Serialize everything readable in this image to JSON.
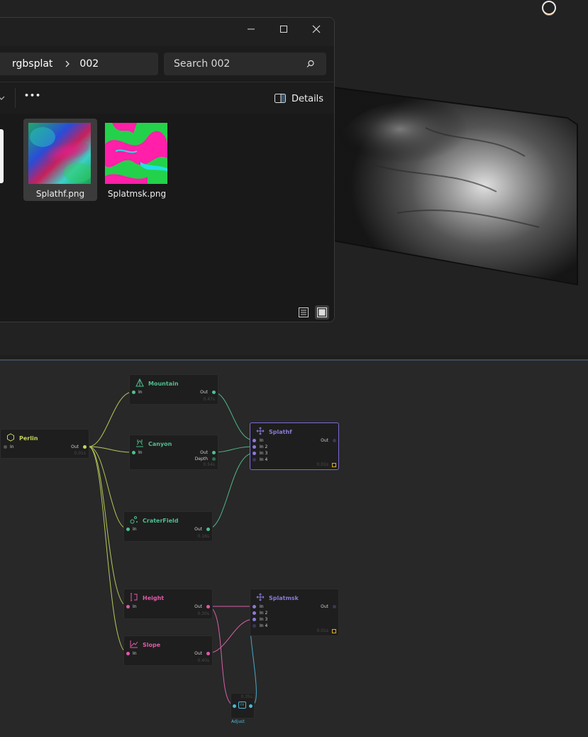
{
  "explorer": {
    "breadcrumb": [
      "rgbsplat",
      "002"
    ],
    "search_placeholder": "Search 002",
    "more_label": "•••",
    "details_label": "Details",
    "files": [
      {
        "name": "Splathf.png",
        "selected": true
      },
      {
        "name": "Splatmsk.png",
        "selected": false
      }
    ]
  },
  "node_editor": {
    "nodes": {
      "perlin": {
        "title": "Perlin",
        "in": "In",
        "out": "Out",
        "time": "0.01s"
      },
      "mountain": {
        "title": "Mountain",
        "in": "In",
        "out": "Out",
        "time": "0.47s"
      },
      "canyon": {
        "title": "Canyon",
        "in": "In",
        "out": "Out",
        "out2": "Depth",
        "time": "0.54s"
      },
      "craterfield": {
        "title": "CraterField",
        "in": "In",
        "out": "Out",
        "time": "0.16s"
      },
      "splathf": {
        "title": "Splathf",
        "inputs": [
          "In",
          "In 2",
          "In 3",
          "In 4"
        ],
        "out": "Out",
        "time": "0.01s"
      },
      "height": {
        "title": "Height",
        "in": "In",
        "out": "Out",
        "time": "0.30s"
      },
      "slope": {
        "title": "Slope",
        "in": "In",
        "out": "Out",
        "time": "0.40s"
      },
      "splatmsk": {
        "title": "Splatmsk",
        "inputs": [
          "In",
          "In 2",
          "In 3",
          "In 4"
        ],
        "out": "Out",
        "time": "0.01s"
      },
      "adjust": {
        "title": "Adjust",
        "time": "0.35s",
        "icon_text": "FX"
      }
    },
    "colors": {
      "perlin": "#c8d65a",
      "terrain": "#4fbf8f",
      "output": "#8a7ad8",
      "selector": "#e05aa8",
      "adjust": "#4fb8d8",
      "wire_perlin": "#b5c85a",
      "wire_terrain": "#4fb88a",
      "wire_pink": "#d860a8",
      "wire_blue": "#4aa8c8"
    }
  }
}
